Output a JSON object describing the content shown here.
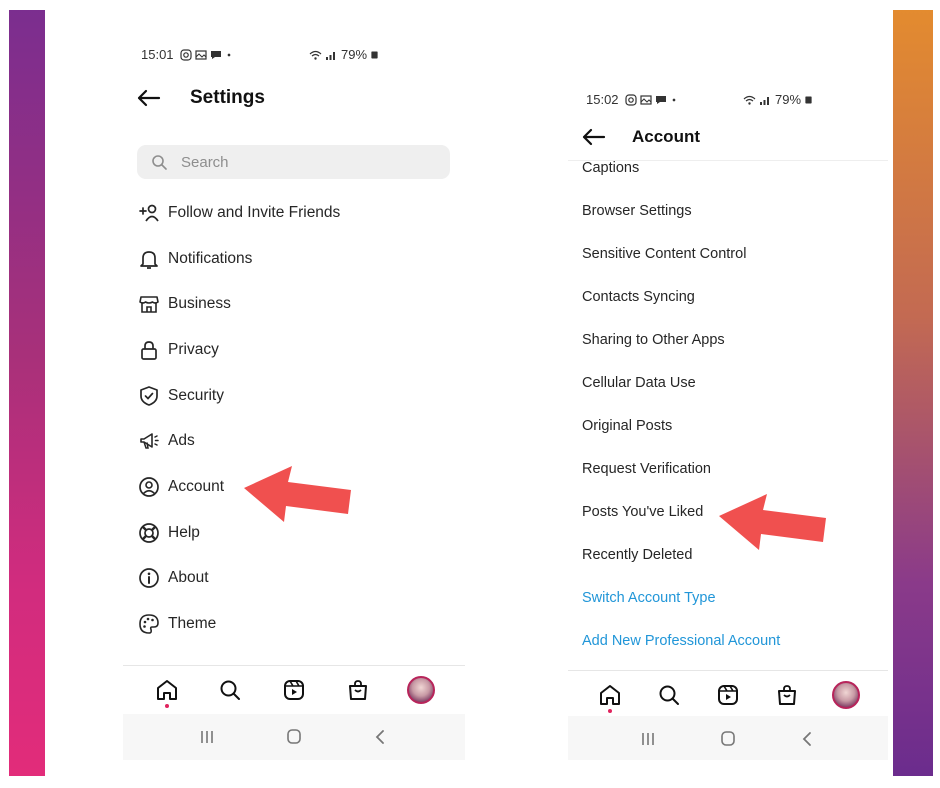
{
  "colors": {
    "left_bar": "#7b2e8f",
    "right_bar": "#e38b2f",
    "link_blue": "#2196d8",
    "arrow_red": "#f0504f"
  },
  "left_screen": {
    "status": {
      "time": "15:01",
      "battery": "79%"
    },
    "header": {
      "title": "Settings",
      "back_icon": "arrow-left-icon"
    },
    "search": {
      "placeholder": "Search",
      "value": ""
    },
    "menu": [
      {
        "label": "Follow and Invite Friends",
        "icon": "add-person-icon"
      },
      {
        "label": "Notifications",
        "icon": "bell-icon"
      },
      {
        "label": "Business",
        "icon": "storefront-icon"
      },
      {
        "label": "Privacy",
        "icon": "lock-icon"
      },
      {
        "label": "Security",
        "icon": "shield-check-icon"
      },
      {
        "label": "Ads",
        "icon": "megaphone-icon"
      },
      {
        "label": "Account",
        "icon": "account-circle-icon"
      },
      {
        "label": "Help",
        "icon": "lifebuoy-icon"
      },
      {
        "label": "About",
        "icon": "info-icon"
      },
      {
        "label": "Theme",
        "icon": "palette-icon"
      }
    ],
    "tabbar": [
      "home-icon",
      "search-icon",
      "reels-icon",
      "shop-icon",
      "profile-avatar"
    ],
    "navbar": [
      "recent-apps-icon",
      "home-button-icon",
      "back-chevron-icon"
    ]
  },
  "right_screen": {
    "status": {
      "time": "15:02",
      "battery": "79%"
    },
    "header": {
      "title": "Account",
      "back_icon": "arrow-left-icon"
    },
    "items": [
      {
        "label": "Captions",
        "style": "normal"
      },
      {
        "label": "Browser Settings",
        "style": "normal"
      },
      {
        "label": "Sensitive Content Control",
        "style": "normal"
      },
      {
        "label": "Contacts Syncing",
        "style": "normal"
      },
      {
        "label": "Sharing to Other Apps",
        "style": "normal"
      },
      {
        "label": "Cellular Data Use",
        "style": "normal"
      },
      {
        "label": "Original Posts",
        "style": "normal"
      },
      {
        "label": "Request Verification",
        "style": "normal"
      },
      {
        "label": "Posts You've Liked",
        "style": "normal"
      },
      {
        "label": "Recently Deleted",
        "style": "normal"
      },
      {
        "label": "Switch Account Type",
        "style": "link"
      },
      {
        "label": "Add New Professional Account",
        "style": "link"
      }
    ],
    "tabbar": [
      "home-icon",
      "search-icon",
      "reels-icon",
      "shop-icon",
      "profile-avatar"
    ],
    "navbar": [
      "recent-apps-icon",
      "home-button-icon",
      "back-chevron-icon"
    ]
  },
  "annotations": [
    {
      "target": "Account",
      "icon": "red-pointer-arrow"
    },
    {
      "target": "Posts You've Liked",
      "icon": "red-pointer-arrow"
    }
  ]
}
